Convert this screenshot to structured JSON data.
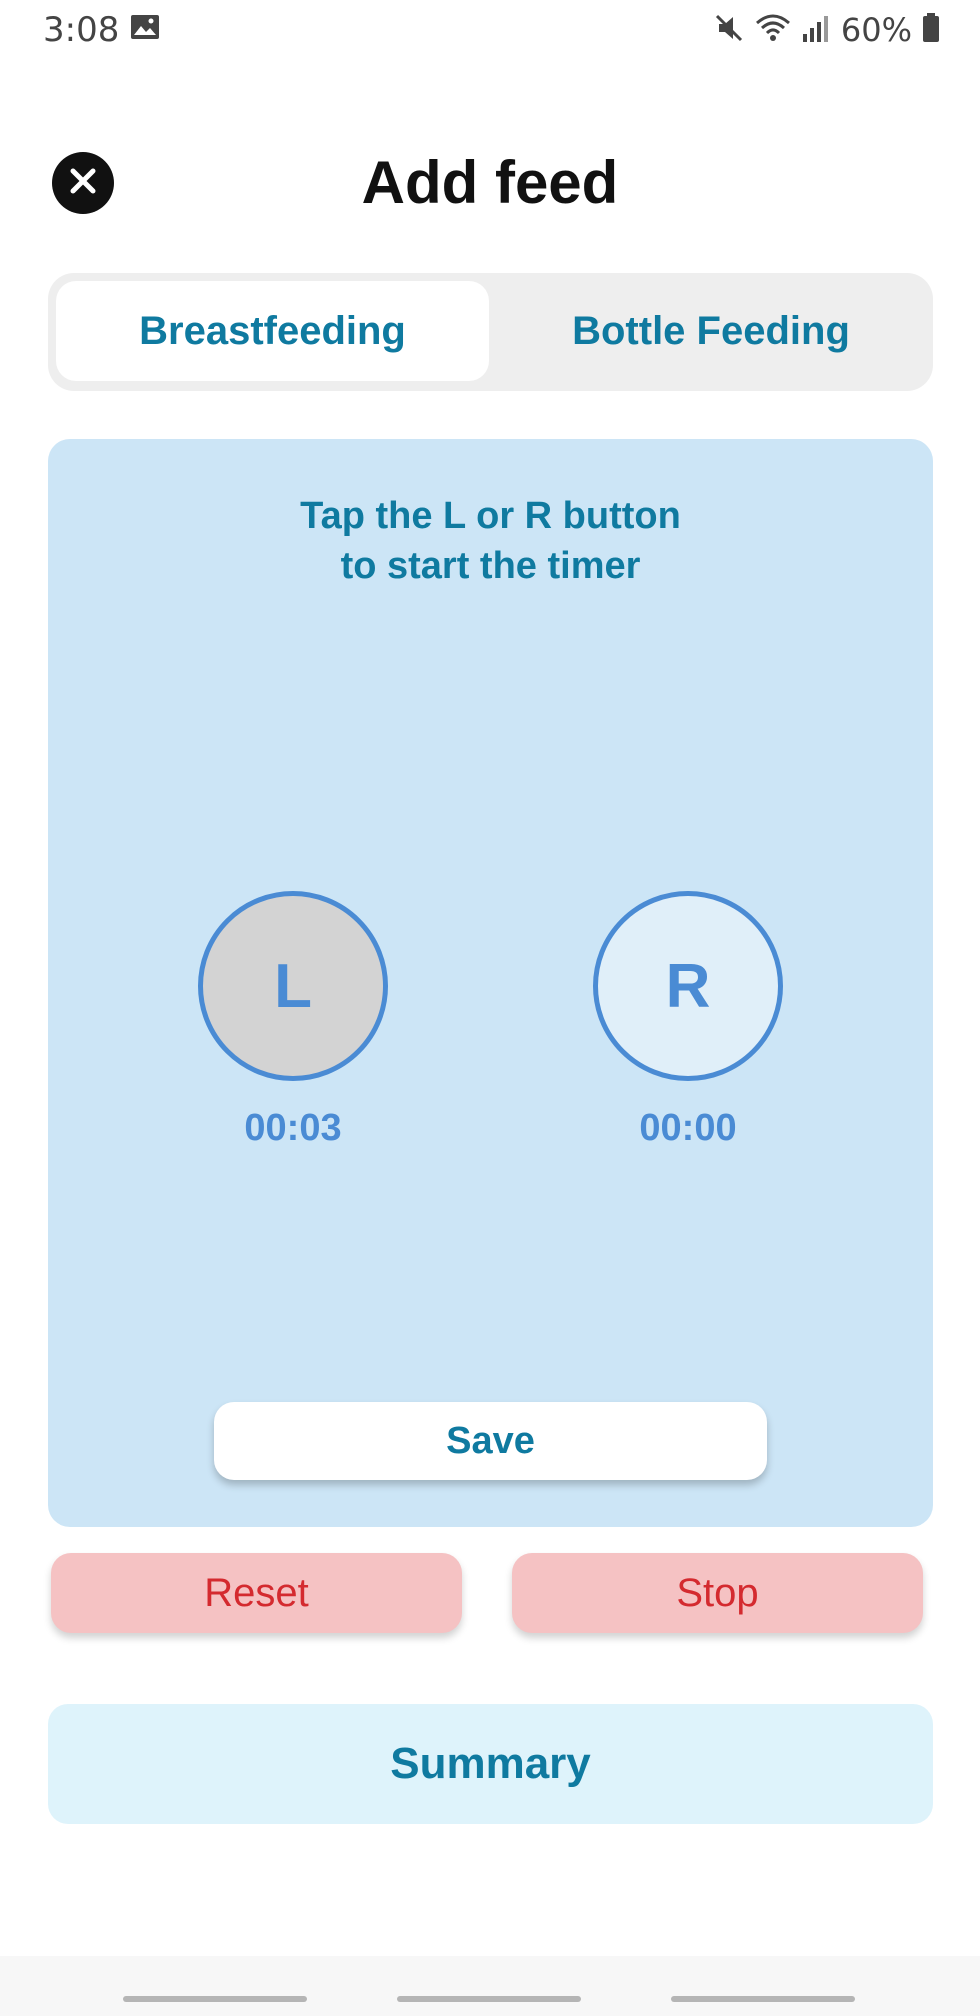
{
  "status_bar": {
    "time": "3:08",
    "battery": "60%",
    "icons": [
      "image-icon",
      "mute-icon",
      "wifi-icon",
      "signal-icon",
      "battery-icon"
    ]
  },
  "header": {
    "title": "Add feed",
    "close_icon": "close-icon"
  },
  "tabs": [
    {
      "label": "Breastfeeding",
      "active": true
    },
    {
      "label": "Bottle Feeding",
      "active": false
    }
  ],
  "timer": {
    "instruction_line1": "Tap the L or R button",
    "instruction_line2": "to start the timer",
    "left": {
      "label": "L",
      "time": "00:03",
      "active": true
    },
    "right": {
      "label": "R",
      "time": "00:00",
      "active": false
    },
    "save_label": "Save"
  },
  "actions": {
    "reset_label": "Reset",
    "stop_label": "Stop"
  },
  "summary_label": "Summary",
  "colors": {
    "accent": "#0f7aa0",
    "timer_blue": "#4a8bd4",
    "panel_bg": "#cce5f6",
    "danger_text": "#d42a2f",
    "danger_bg": "#f5c2c3",
    "summary_bg": "#def3fb"
  }
}
